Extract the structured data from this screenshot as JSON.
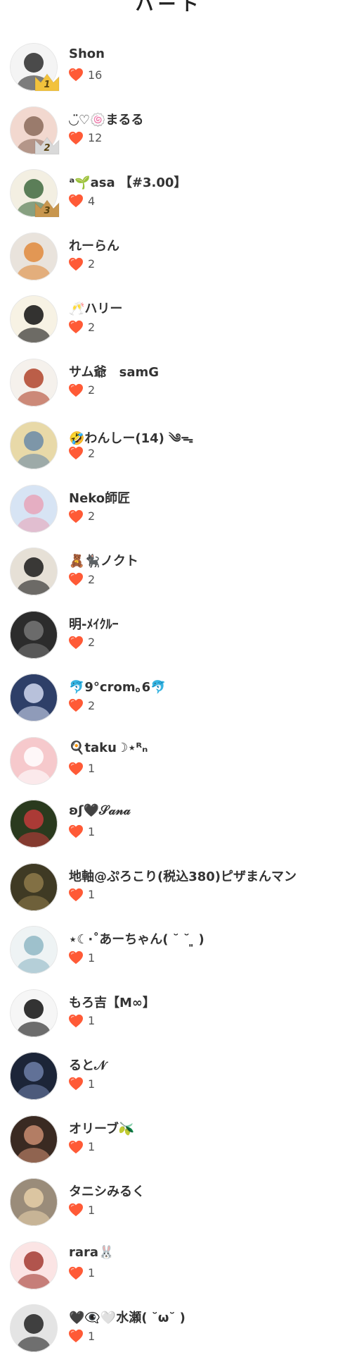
{
  "header": {
    "title": "ハート"
  },
  "colors": {
    "heart": "#ff5a36",
    "gold": "#f2c23c",
    "silver": "#d9d9d9",
    "bronze": "#c8964e"
  },
  "rows": [
    {
      "name": "Shon",
      "likes": "16",
      "rank": "1",
      "avatar_bg": "#f4f4f4",
      "avatar_fg": "#2b2b2b"
    },
    {
      "name": "◡̈♡🍥まるる",
      "likes": "12",
      "rank": "2",
      "avatar_bg": "#f2d8cf",
      "avatar_fg": "#8b6b5a"
    },
    {
      "name": "ᵃ🌱asa 【#3.00】",
      "likes": "4",
      "rank": "3",
      "avatar_bg": "#f3efe2",
      "avatar_fg": "#3f6a3f"
    },
    {
      "name": "れーらん",
      "likes": "2",
      "avatar_bg": "#e9e3dc",
      "avatar_fg": "#e08a3c"
    },
    {
      "name": "🥂ハリー",
      "likes": "2",
      "avatar_bg": "#f7f2e4",
      "avatar_fg": "#111111"
    },
    {
      "name": "サム爺　samG",
      "likes": "2",
      "avatar_bg": "#f5f1ec",
      "avatar_fg": "#b0442c"
    },
    {
      "name": "🤣わんしー(14) ༄ᯓ",
      "likes": "2",
      "avatar_bg": "#e8d9a8",
      "avatar_fg": "#6a8aa8"
    },
    {
      "name": "Neko師匠",
      "likes": "2",
      "avatar_bg": "#d7e4f4",
      "avatar_fg": "#e7a5b8"
    },
    {
      "name": "🧸🐈‍⬛ノクト",
      "likes": "2",
      "avatar_bg": "#e6e0d6",
      "avatar_fg": "#1a1a1a"
    },
    {
      "name": "明-ﾒｲｸﾙｰ",
      "likes": "2",
      "avatar_bg": "#2c2c2c",
      "avatar_fg": "#777777"
    },
    {
      "name": "🐬9°crom｡6🐬",
      "likes": "2",
      "avatar_bg": "#2e3f68",
      "avatar_fg": "#d0d8f0"
    },
    {
      "name": "🍳taku☽⋆ᴿₙ",
      "likes": "1",
      "avatar_bg": "#f6c9cc",
      "avatar_fg": "#ffffff"
    },
    {
      "name": "ʚʃ🖤𝒮𝒶𝓃𝒶",
      "likes": "1",
      "avatar_bg": "#2a3a1e",
      "avatar_fg": "#c23b3b"
    },
    {
      "name": "地軸@ぷろこり(税込380)ピザまんマン",
      "likes": "1",
      "avatar_bg": "#3f3a24",
      "avatar_fg": "#8e7a4a"
    },
    {
      "name": "⋆☾·˚あーちゃん( ˘ ˘ ͈ )",
      "likes": "1",
      "avatar_bg": "#eef3f4",
      "avatar_fg": "#8fb7c4"
    },
    {
      "name": "もろ吉【M∞】",
      "likes": "1",
      "avatar_bg": "#f6f6f6",
      "avatar_fg": "#111111"
    },
    {
      "name": "ると𝒩",
      "likes": "1",
      "avatar_bg": "#1c2538",
      "avatar_fg": "#6d7fa8"
    },
    {
      "name": "オリーブ🫒",
      "likes": "1",
      "avatar_bg": "#3a2a22",
      "avatar_fg": "#c98c70"
    },
    {
      "name": "タニシみるく",
      "likes": "1",
      "avatar_bg": "#9a8c7a",
      "avatar_fg": "#e6cfa8"
    },
    {
      "name": "rara🐰",
      "likes": "1",
      "avatar_bg": "#fbe4e4",
      "avatar_fg": "#a33b32"
    },
    {
      "name": "🖤👁‍🗨🤍水瀬( ˘ω˘ )",
      "likes": "1",
      "avatar_bg": "#e4e4e4",
      "avatar_fg": "#222222"
    }
  ]
}
